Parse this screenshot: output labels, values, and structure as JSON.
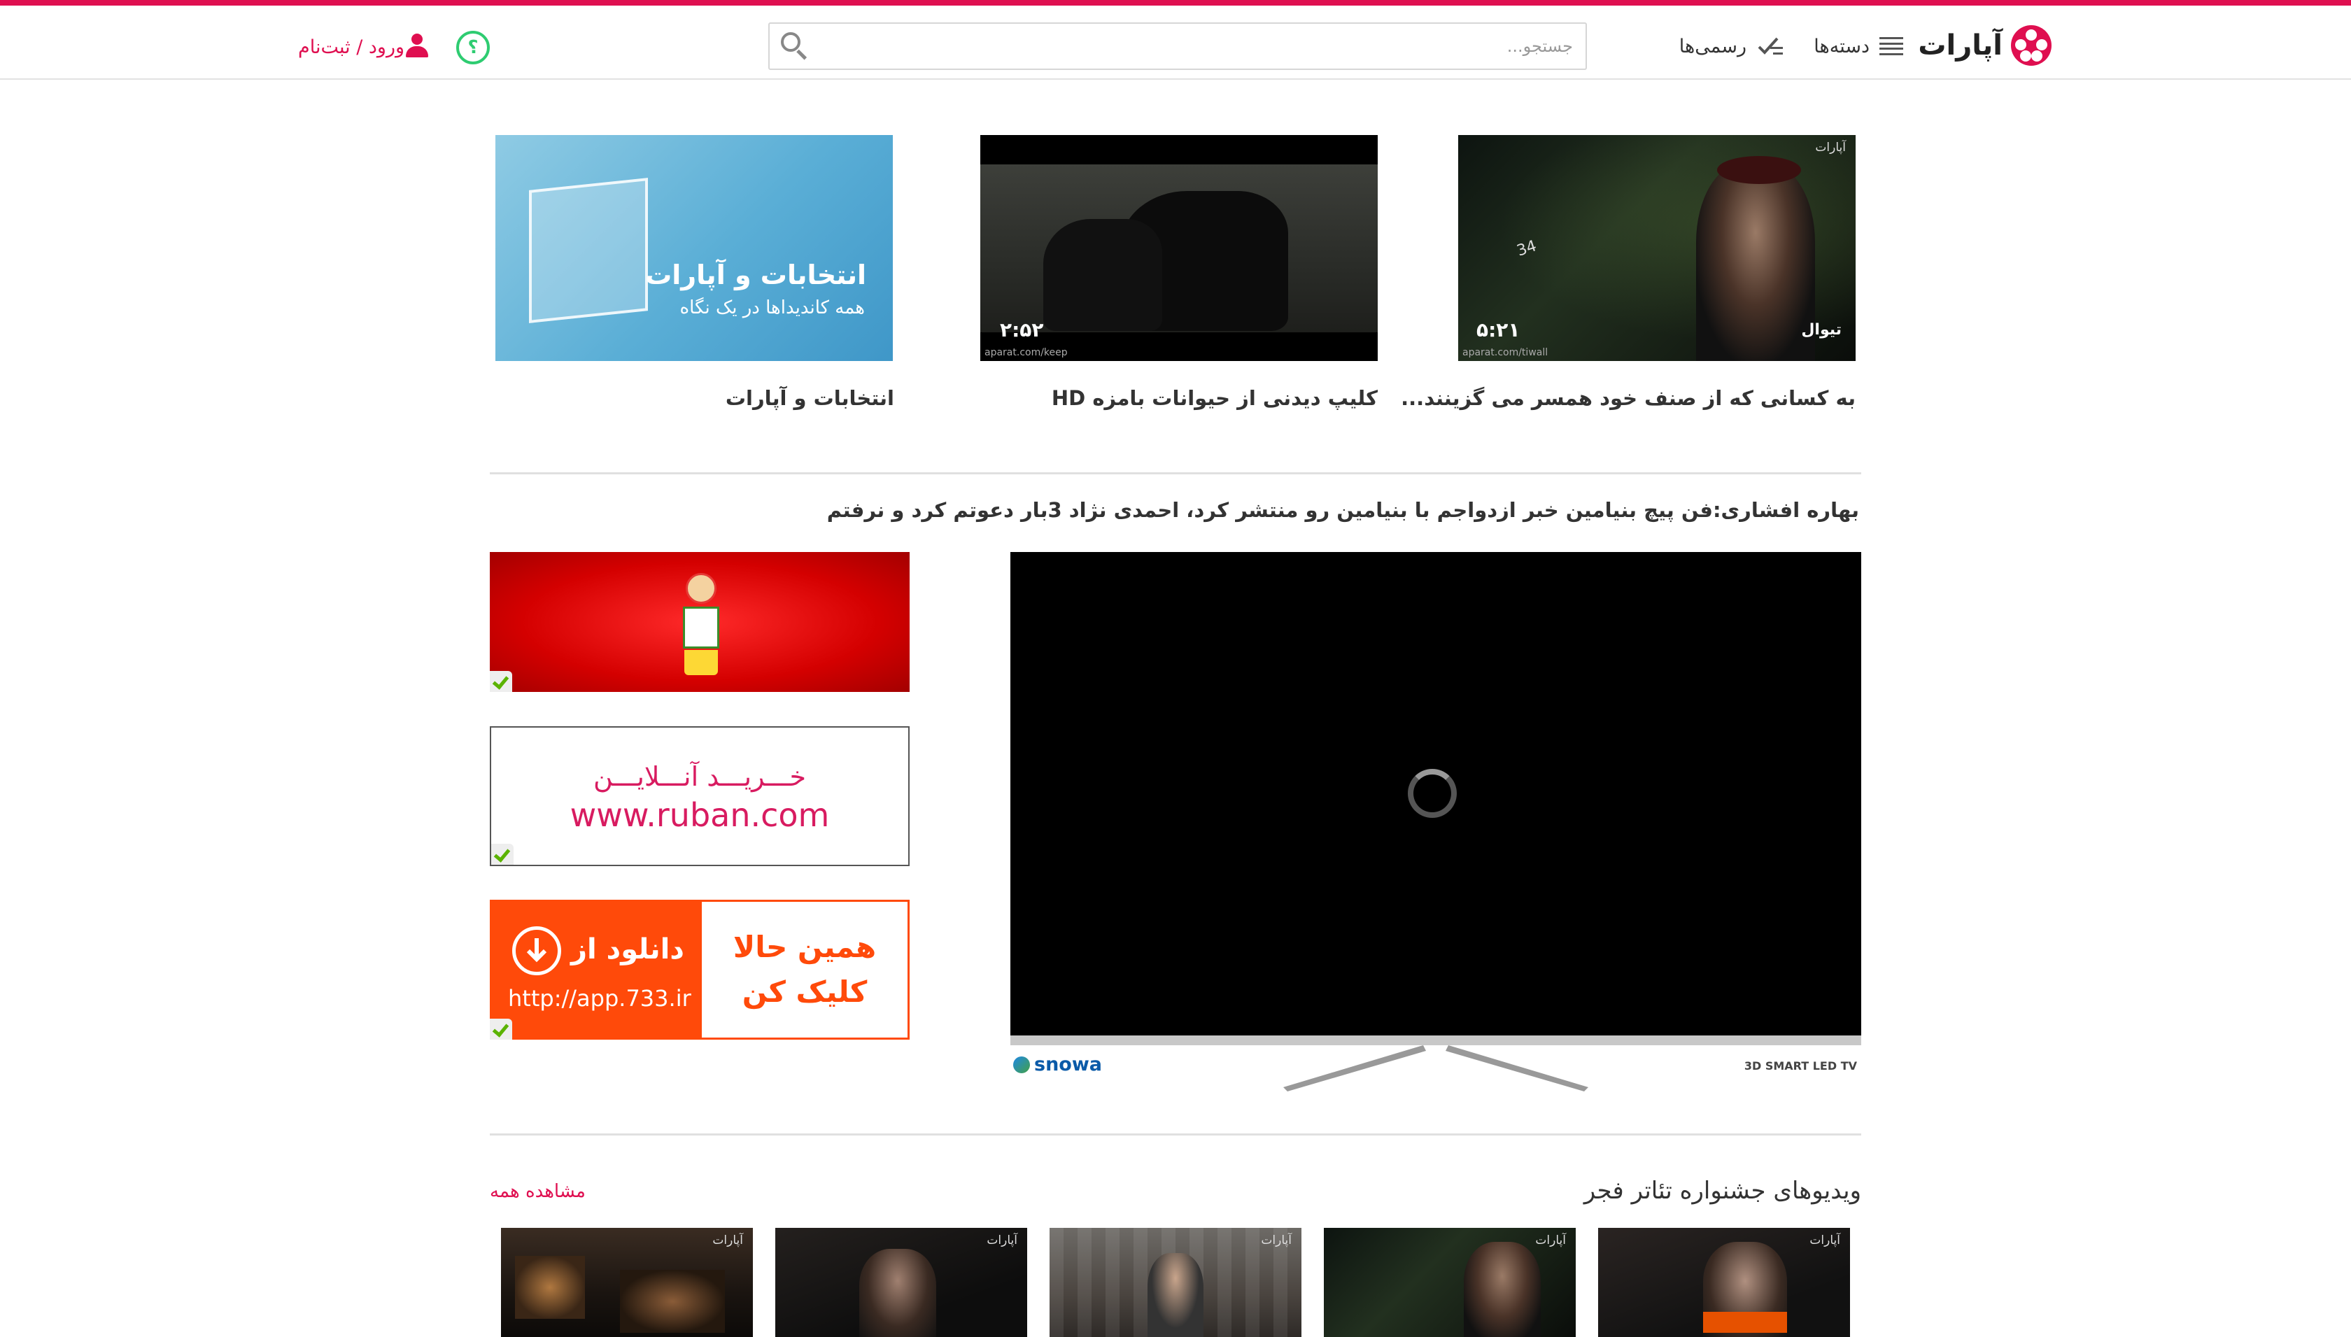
{
  "header": {
    "logo_text": "آپارات",
    "nav": {
      "categories": "دسته‌ها",
      "official": "رسمی‌ها"
    },
    "search_placeholder": "جستجو...",
    "help_glyph": "؟",
    "login_label": "ورود / ثبت‌نام"
  },
  "featured": [
    {
      "title": "به کسانی که از صنف خود همسر می گزینند...",
      "duration": "۵:۲۱",
      "channel": "تیوال",
      "watermark": "آپارات",
      "url_watermark": "aparat.com/tiwall",
      "overlay_note": "34"
    },
    {
      "title": "کلیپ دیدنی از حیوانات بامزه HD",
      "duration": "۲:۵۲",
      "url_watermark": "aparat.com/keep"
    },
    {
      "title": "انتخابات و آپارات",
      "banner_title": "انتخابات و آپارات",
      "banner_sub": "همه کاندیداها در یک نگاه"
    }
  ],
  "main_video": {
    "title": "بهاره افشاری:فن پیچ بنیامین خبر ازدواجم با بنیامین رو منتشر کرد، احمدی نژاد 3بار دعوتم کرد و نرفتم",
    "brand": "snowa",
    "tv_label": "3D SMART LED TV"
  },
  "ads": [
    {
      "type": "mascot"
    },
    {
      "line1": "خـــریـــد آنـــلایـــن",
      "line2": "www.ruban.com"
    },
    {
      "left_line1": "دانلود از",
      "left_line2": "http://app.733.ir",
      "right_line1": "همین حالا",
      "right_line2": "کلیک کن"
    }
  ],
  "festival": {
    "heading": "ویدیوهای جشنواره تئاتر فجر",
    "see_all": "مشاهده همه",
    "watermark": "آپارات"
  },
  "colors": {
    "brand": "#df0f50",
    "green": "#2ecc71"
  }
}
